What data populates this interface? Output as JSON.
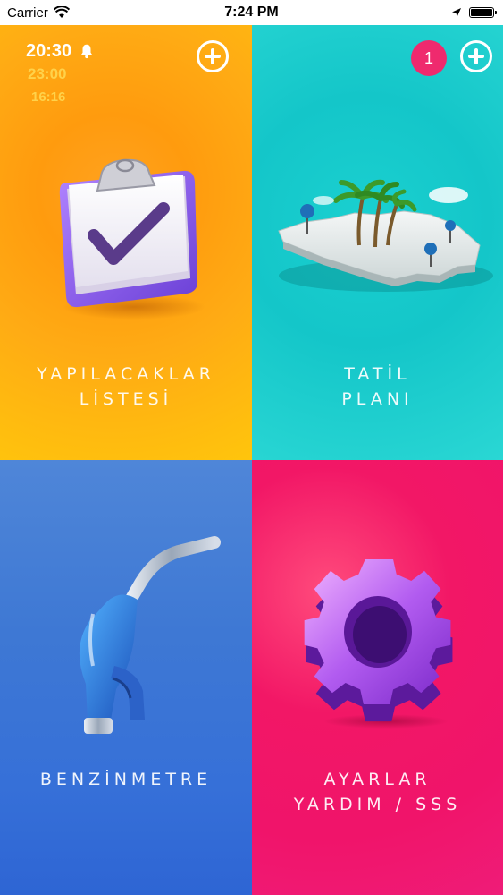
{
  "status_bar": {
    "carrier": "Carrier",
    "time": "7:24 PM"
  },
  "tiles": {
    "todo": {
      "label_line1": "YAPILACAKLAR",
      "label_line2": "LİSTESİ",
      "alarms": [
        "20:30",
        "23:00",
        "16:16"
      ],
      "color": "#ff9b0e"
    },
    "vacation": {
      "label_line1": "TATİL",
      "label_line2": "PLANI",
      "badge_count": "1",
      "color": "#14c6c9"
    },
    "fuel": {
      "label_line1": "BENZİNMETRE",
      "color": "#3e78d4"
    },
    "settings": {
      "label_line1": "AYARLAR",
      "label_line2": "YARDIM / SSS",
      "color": "#f0146a"
    }
  },
  "icons": {
    "todo": "clipboard-check-icon",
    "vacation": "island-map-icon",
    "fuel": "fuel-nozzle-icon",
    "settings": "gear-icon",
    "alarm": "bell-icon",
    "add": "plus-circle-icon"
  }
}
